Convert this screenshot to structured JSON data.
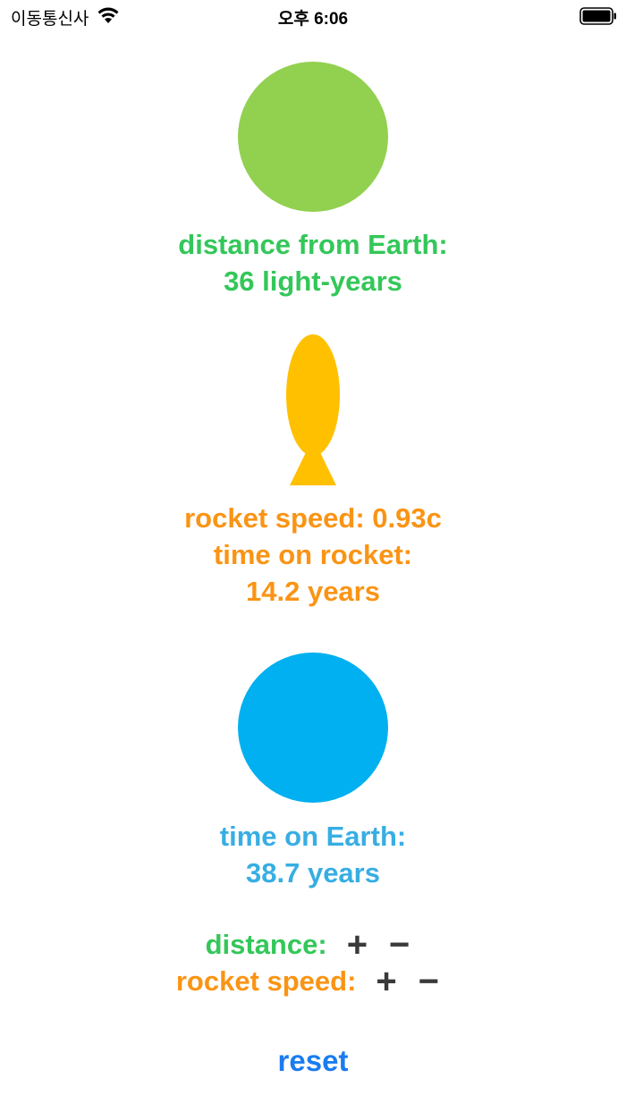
{
  "status_bar": {
    "carrier": "이동통신사",
    "time": "오후 6:06"
  },
  "colors": {
    "destination_planet": "#92d050",
    "rocket": "#ffc000",
    "earth": "#00b0f0",
    "distance_text": "#33c759",
    "rocket_text": "#fa9414",
    "earth_text": "#37aee3",
    "reset": "#1a7cf0"
  },
  "destination": {
    "line1": "distance from Earth:",
    "line2": "36 light-years"
  },
  "rocket": {
    "line1": "rocket speed: 0.93c",
    "line2": "time on rocket:",
    "line3": "14.2 years"
  },
  "earth": {
    "line1": "time on Earth:",
    "line2": "38.7 years"
  },
  "controls": {
    "distance_label": "distance:",
    "speed_label": "rocket speed:",
    "plus": "+",
    "minus": "−"
  },
  "reset_label": "reset"
}
